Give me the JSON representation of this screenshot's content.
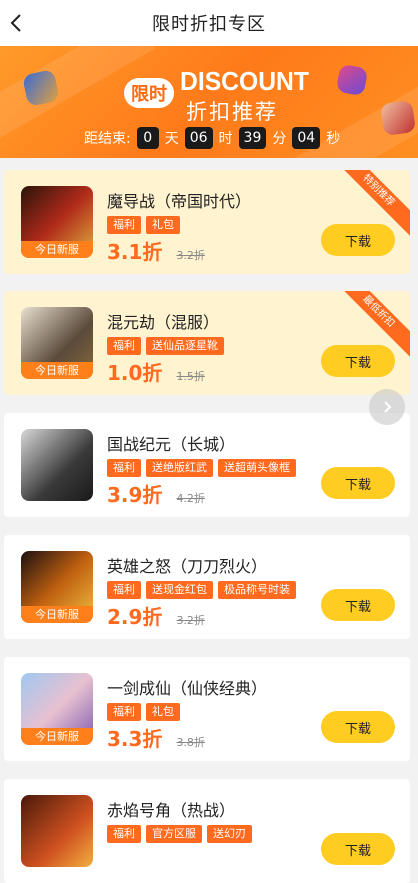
{
  "header": {
    "title": "限时折扣专区"
  },
  "banner": {
    "badge": "限时",
    "headline": "DISCOUNT",
    "subheadline": "折扣推荐",
    "countdown_label": "距结束:",
    "days": "0",
    "days_unit": "天",
    "hours": "06",
    "hours_unit": "时",
    "minutes": "39",
    "minutes_unit": "分",
    "seconds": "04",
    "seconds_unit": "秒"
  },
  "games": [
    {
      "name": "魔导战（帝国时代）",
      "tags": [
        "福利",
        "礼包"
      ],
      "price": "3.1折",
      "old_price": "3.2折",
      "button": "下载",
      "icon_tag": "今日新服",
      "ribbon": "特别推荐",
      "highlight": true
    },
    {
      "name": "混元劫（混服）",
      "tags": [
        "福利",
        "送仙品逐星靴"
      ],
      "price": "1.0折",
      "old_price": "1.5折",
      "button": "下载",
      "icon_tag": "今日新服",
      "ribbon": "最低折扣",
      "highlight": true
    },
    {
      "name": "国战纪元（长城）",
      "tags": [
        "福利",
        "送绝版红武",
        "送超萌头像框"
      ],
      "price": "3.9折",
      "old_price": "4.2折",
      "button": "下载",
      "icon_tag": "",
      "ribbon": "",
      "highlight": false
    },
    {
      "name": "英雄之怒（刀刀烈火）",
      "tags": [
        "福利",
        "送现金红包",
        "极品称号时装"
      ],
      "price": "2.9折",
      "old_price": "3.2折",
      "button": "下载",
      "icon_tag": "今日新服",
      "ribbon": "",
      "highlight": false
    },
    {
      "name": "一剑成仙（仙侠经典）",
      "tags": [
        "福利",
        "礼包"
      ],
      "price": "3.3折",
      "old_price": "3.8折",
      "button": "下载",
      "icon_tag": "今日新服",
      "ribbon": "",
      "highlight": false
    },
    {
      "name": "赤焰号角（热战）",
      "tags": [
        "福利",
        "官方区服",
        "送幻刃"
      ],
      "price": "",
      "old_price": "",
      "button": "下载",
      "icon_tag": "",
      "ribbon": "",
      "highlight": false
    }
  ],
  "colors": {
    "accent": "#ff6a1e",
    "button": "#ffcc22",
    "highlight_bg": "#fff3d0"
  }
}
